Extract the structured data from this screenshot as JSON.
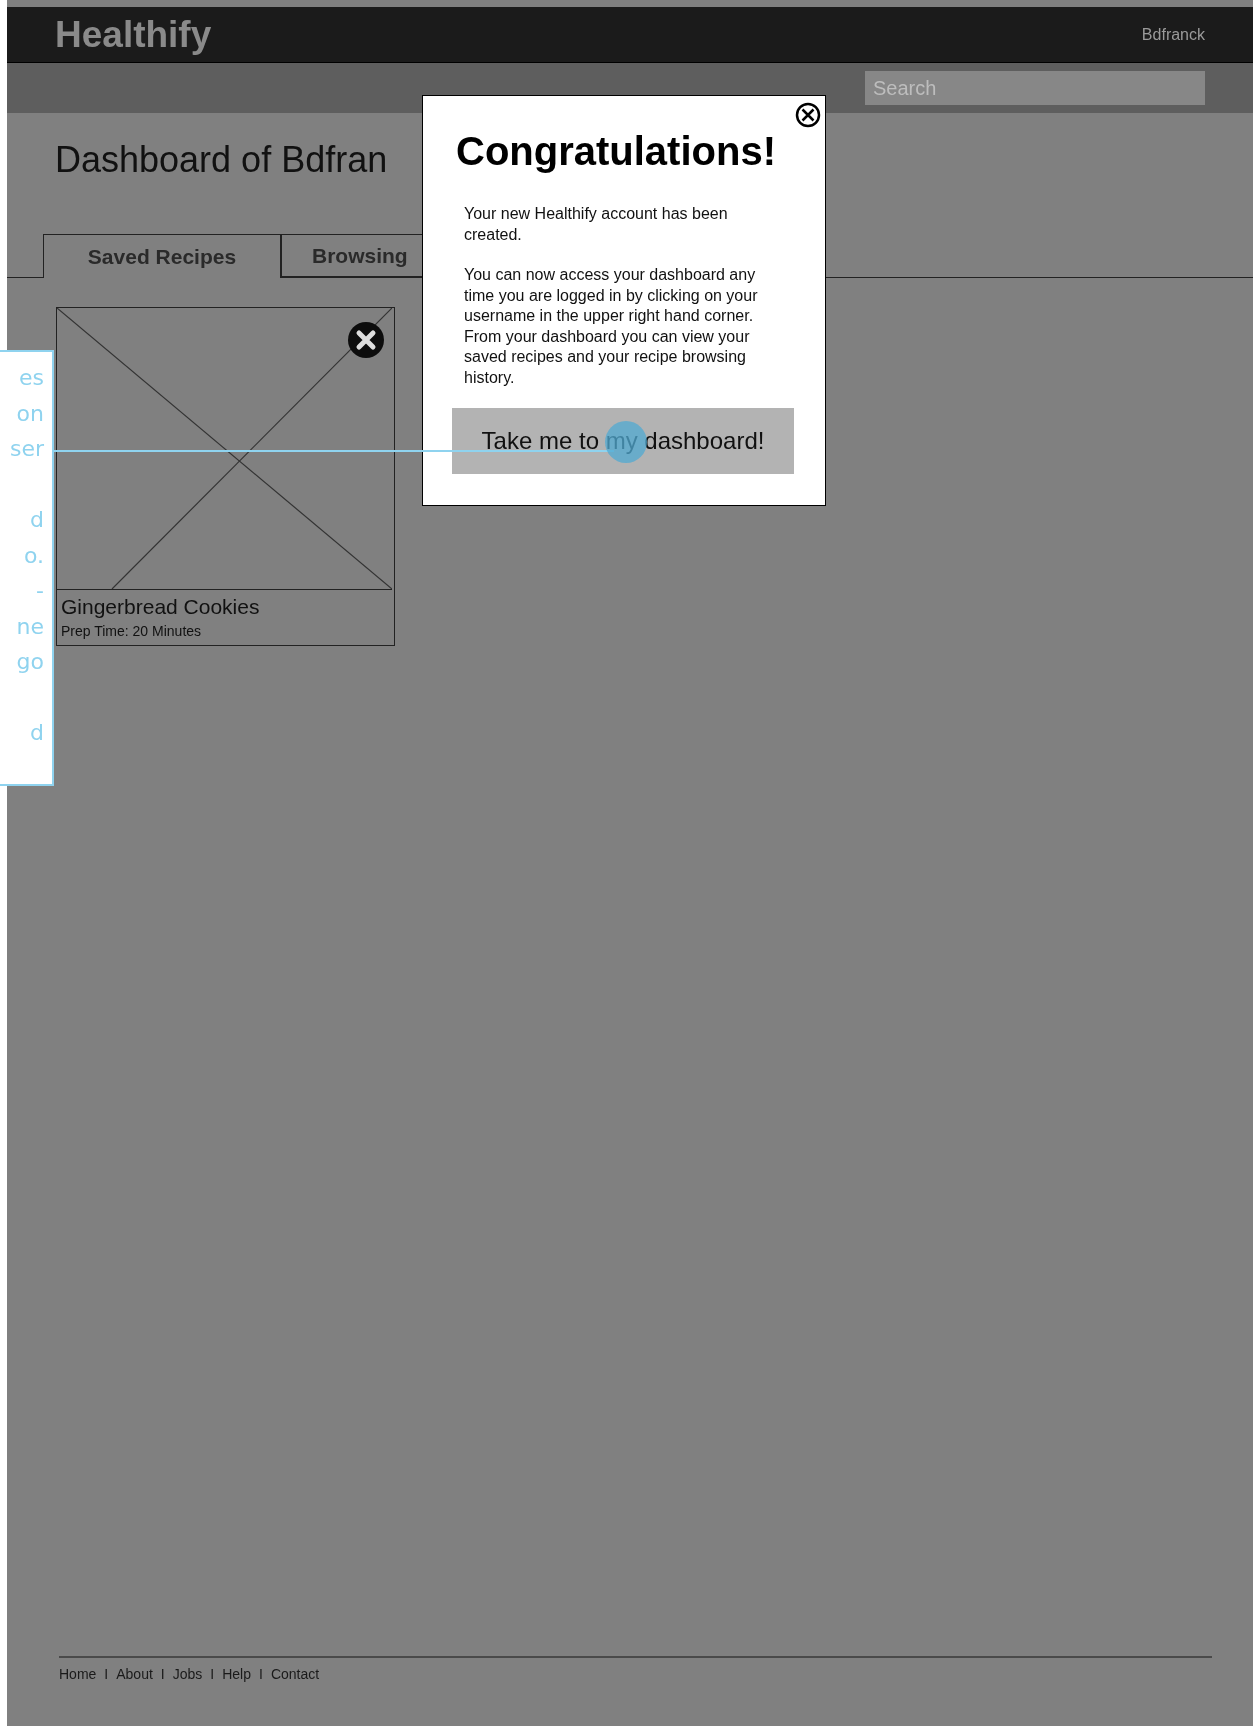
{
  "header": {
    "logo": "Healthify",
    "username": "Bdfranck"
  },
  "search": {
    "placeholder": "Search"
  },
  "page_title": "Dashboard of Bdfran",
  "tabs": [
    {
      "label": "Saved Recipes",
      "selected": true
    },
    {
      "label": "Browsing",
      "selected": false
    }
  ],
  "recipes": [
    {
      "name": "Gingerbread Cookies",
      "prep_time": "Prep Time: 20 Minutes"
    }
  ],
  "footer": {
    "links": [
      "Home",
      "About",
      "Jobs",
      "Help",
      "Contact"
    ],
    "separators": [
      "I",
      "I",
      "I",
      "I"
    ]
  },
  "modal": {
    "title": "Congratulations!",
    "paragraphs": [
      "Your new Healthify account has been created.",
      "You can now access your dashboard any time you are logged in by clicking on your username in the upper right hand corner. From your dashboard you can view your saved recipes and your recipe browsing history."
    ],
    "button": "Take me to my dashboard!"
  },
  "annotation": {
    "text": "es\non\nser\n\nd\no.\n-\nne\ngo\n\nd"
  }
}
